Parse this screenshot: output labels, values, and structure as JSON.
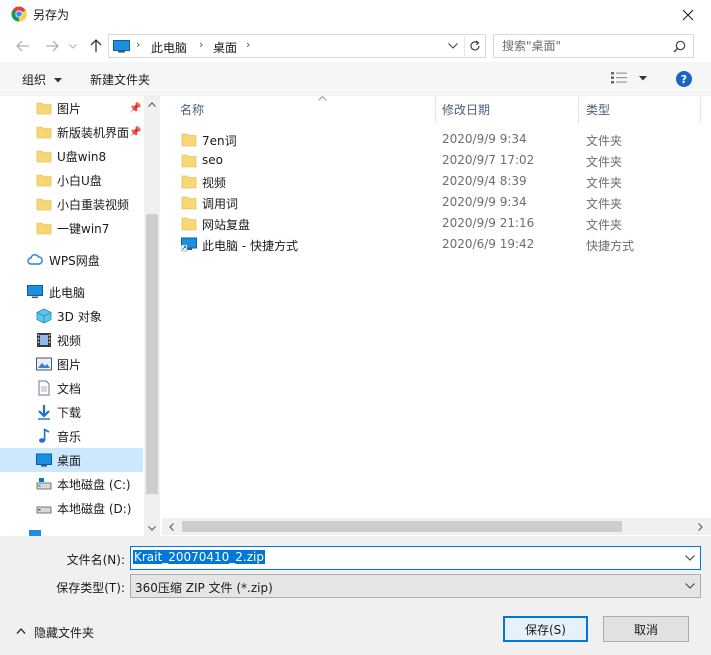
{
  "window": {
    "title": "另存为"
  },
  "address": {
    "crumbs": [
      "此电脑",
      "桌面"
    ]
  },
  "search": {
    "placeholder": "搜索\"桌面\""
  },
  "toolbar": {
    "organize": "组织",
    "new_folder": "新建文件夹",
    "help": "?"
  },
  "nav": {
    "quick_access": [
      {
        "label": "图片",
        "pinned": true
      },
      {
        "label": "新版装机界面",
        "pinned": true
      },
      {
        "label": "U盘win8",
        "pinned": false
      },
      {
        "label": "小白U盘",
        "pinned": false
      },
      {
        "label": "小白重装视频",
        "pinned": false
      },
      {
        "label": "一键win7",
        "pinned": false
      }
    ],
    "wps": "WPS网盘",
    "this_pc": "此电脑",
    "pc_items": [
      "3D 对象",
      "视频",
      "图片",
      "文档",
      "下载",
      "音乐",
      "桌面",
      "本地磁盘 (C:)",
      "本地磁盘 (D:)"
    ],
    "selected": "桌面"
  },
  "columns": {
    "name": "名称",
    "date": "修改日期",
    "type": "类型"
  },
  "files": [
    {
      "name": "7en词",
      "date": "2020/9/9 9:34",
      "type": "文件夹",
      "icon": "folder"
    },
    {
      "name": "seo",
      "date": "2020/9/7 17:02",
      "type": "文件夹",
      "icon": "folder"
    },
    {
      "name": "视频",
      "date": "2020/9/4 8:39",
      "type": "文件夹",
      "icon": "folder"
    },
    {
      "name": "调用词",
      "date": "2020/9/9 9:34",
      "type": "文件夹",
      "icon": "folder"
    },
    {
      "name": "网站复盘",
      "date": "2020/9/9 21:16",
      "type": "文件夹",
      "icon": "folder"
    },
    {
      "name": "此电脑 - 快捷方式",
      "date": "2020/6/9 19:42",
      "type": "快捷方式",
      "icon": "shortcut"
    }
  ],
  "form": {
    "filename_label": "文件名(N):",
    "filename_value": "Krait_20070410_2.zip",
    "filetype_label": "保存类型(T):",
    "filetype_value": "360压缩 ZIP 文件 (*.zip)",
    "hide_folders": "隐藏文件夹",
    "save": "保存(S)",
    "cancel": "取消"
  },
  "colors": {
    "accent": "#0078d7",
    "folder": "#f8d775",
    "selected_bg": "#cce8ff"
  }
}
